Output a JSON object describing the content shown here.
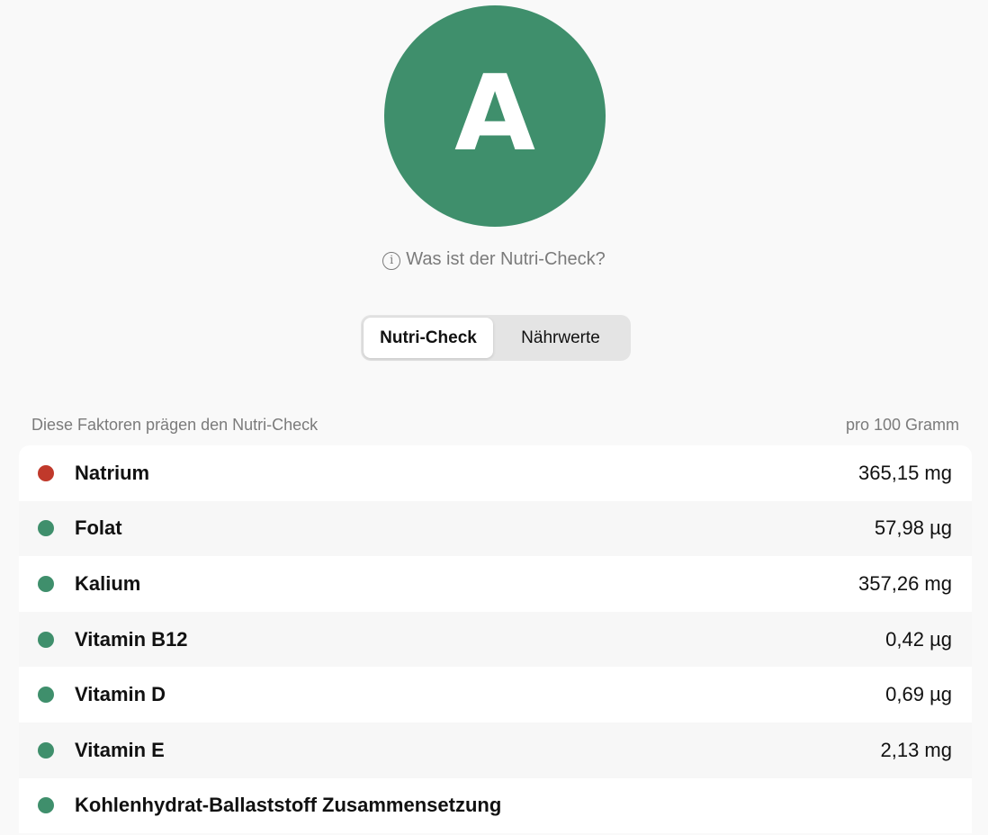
{
  "grade": {
    "letter": "A",
    "color": "#3f8f6c"
  },
  "info_link": {
    "icon": "info-circle-icon",
    "label": "Was ist der Nutri-Check?"
  },
  "tabs": [
    {
      "label": "Nutri-Check",
      "active": true
    },
    {
      "label": "Nährwerte",
      "active": false
    }
  ],
  "list": {
    "header_left": "Diese Faktoren prägen den Nutri-Check",
    "header_right": "pro 100 Gramm",
    "status_colors": {
      "bad": "#c0392b",
      "good": "#3f8f6c"
    },
    "items": [
      {
        "name": "Natrium",
        "value": "365,15 mg",
        "status": "bad"
      },
      {
        "name": "Folat",
        "value": "57,98 µg",
        "status": "good"
      },
      {
        "name": "Kalium",
        "value": "357,26 mg",
        "status": "good"
      },
      {
        "name": "Vitamin B12",
        "value": "0,42 µg",
        "status": "good"
      },
      {
        "name": "Vitamin D",
        "value": "0,69 µg",
        "status": "good"
      },
      {
        "name": "Vitamin E",
        "value": "2,13 mg",
        "status": "good"
      },
      {
        "name": "Kohlenhydrat-Ballaststoff Zusammensetzung",
        "value": "",
        "status": "good"
      }
    ]
  }
}
